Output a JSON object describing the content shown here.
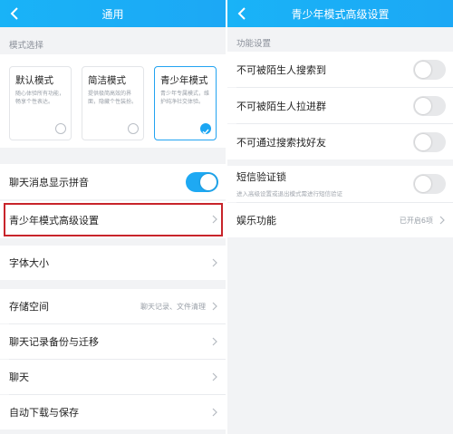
{
  "general": {
    "title": "通用",
    "mode_section": "模式选择",
    "modes": [
      {
        "title": "默认模式",
        "desc": "随心体验所有功能，畅享个性表达。",
        "selected": false
      },
      {
        "title": "简洁模式",
        "desc": "提供极简高效的界面，隐藏个性装扮。",
        "selected": false
      },
      {
        "title": "青少年模式",
        "desc": "青少年专属模式，维护纯净社交体验。",
        "selected": true
      }
    ],
    "pinyin_label": "聊天消息显示拼音",
    "pinyin_on": true,
    "teen_settings_label": "青少年模式高级设置",
    "font_size_label": "字体大小",
    "storage_label": "存储空间",
    "storage_value": "聊天记录、文件清理",
    "backup_label": "聊天记录备份与迁移",
    "chat_label": "聊天",
    "auto_download_label": "自动下载与保存"
  },
  "teen": {
    "title": "青少年模式高级设置",
    "section": "功能设置",
    "toggles": [
      {
        "label": "不可被陌生人搜索到",
        "on": false
      },
      {
        "label": "不可被陌生人拉进群",
        "on": false
      },
      {
        "label": "不可通过搜索找好友",
        "on": false
      }
    ],
    "sms_label": "短信验证锁",
    "sms_sub": "进入高级设置或退出模式需进行短信验证",
    "sms_on": false,
    "entertainment_label": "娱乐功能",
    "entertainment_value": "已开启6项"
  },
  "colors": {
    "accent": "#1ea9f3",
    "highlight": "#c8242a"
  }
}
